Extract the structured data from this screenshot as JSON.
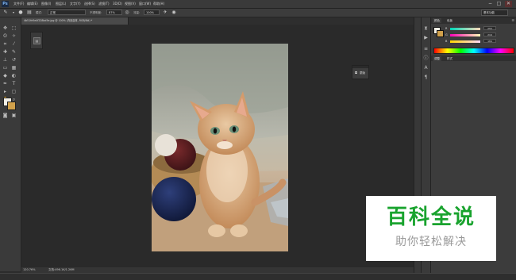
{
  "app": {
    "logo": "Ps"
  },
  "menu": [
    "文件(F)",
    "编辑(E)",
    "图像(I)",
    "图层(L)",
    "文字(Y)",
    "选择(S)",
    "滤镜(T)",
    "3D(D)",
    "视图(V)",
    "窗口(W)",
    "帮助(H)"
  ],
  "window_controls": {
    "minimize": "−",
    "maximize": "□",
    "close": "✕"
  },
  "options": {
    "mode_label": "模式:",
    "mode_value": "正常",
    "opacity_label": "不透明度:",
    "opacity_value": "87%",
    "flow_label": "流量:",
    "flow_value": "100%",
    "workspace": "基本功能"
  },
  "document": {
    "tab_title": "4b51fe5e4f228bd5e.jpg @ 100% (背景副本, RGB/8#) *",
    "status_zoom": "120.76%",
    "status_doc": "文档:496.1K/1.26M"
  },
  "float_panel": {
    "label": "蒙版"
  },
  "panels": {
    "tabs": [
      "颜色",
      "色板"
    ],
    "sliders": [
      {
        "label": "R",
        "value": "255"
      },
      {
        "label": "G",
        "value": "216"
      },
      {
        "label": "B",
        "value": "184"
      }
    ],
    "swatch_tabs": [
      "调整",
      "样式"
    ]
  },
  "colors": {
    "foreground": "#f2efe6",
    "background": "#d1a14b",
    "accent_green": "#19a32e"
  },
  "watermark": {
    "title": "百科全说",
    "subtitle": "助你轻松解决"
  }
}
